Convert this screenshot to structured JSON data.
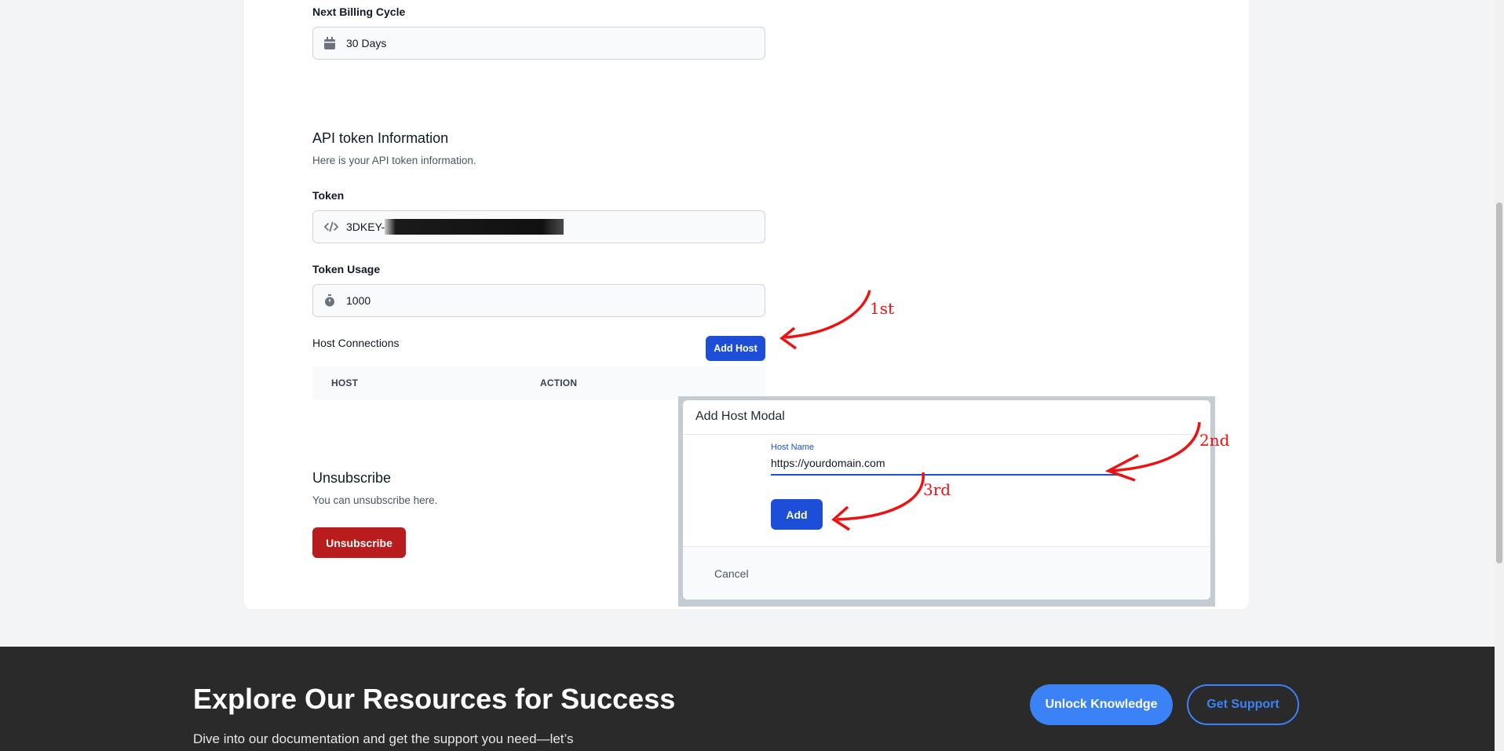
{
  "billing": {
    "label": "Next Billing Cycle",
    "value": "30 Days"
  },
  "api": {
    "title": "API token Information",
    "description": "Here is your API token information.",
    "token_label": "Token",
    "token_value": "3DKEY-",
    "usage_label": "Token Usage",
    "usage_value": "1000"
  },
  "hosts": {
    "title": "Host Connections",
    "add_button": "Add Host",
    "columns": [
      "HOST",
      "ACTION"
    ]
  },
  "unsubscribe": {
    "title": "Unsubscribe",
    "description": "You can unsubscribe here.",
    "button": "Unsubscribe"
  },
  "modal": {
    "title": "Add Host Modal",
    "host_label": "Host Name",
    "host_value": "https://yourdomain.com",
    "add_button": "Add",
    "cancel_button": "Cancel"
  },
  "annotations": [
    "1st",
    "2nd",
    "3rd"
  ],
  "footer": {
    "title": "Explore Our Resources for Success",
    "subtitle": "Dive into our documentation and get the support you need—let’s",
    "unlock_button": "Unlock Knowledge",
    "support_button": "Get Support"
  },
  "icons": {
    "billing": "calendar-icon",
    "token": "code-icon",
    "usage": "stopwatch-icon"
  },
  "colors": {
    "primary": "#1d4ed8",
    "danger": "#b91c1c",
    "footer_bg": "#2a2a2a",
    "footer_accent": "#3b82f6",
    "annotation": "#e11111"
  }
}
